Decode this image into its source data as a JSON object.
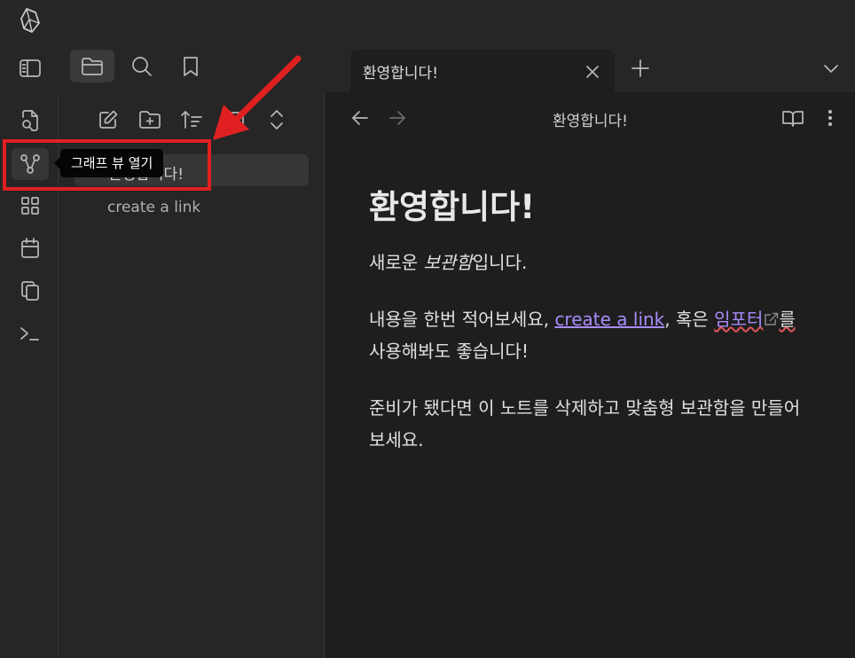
{
  "app": {
    "logo_icon": "obsidian-logo-icon"
  },
  "tabs": [
    {
      "title": "환영합니다!",
      "active": true
    }
  ],
  "tooltip": {
    "text": "그래프 뷰 열기"
  },
  "file_explorer": {
    "items": [
      {
        "label": "환영합니다!",
        "selected": true
      },
      {
        "label": "create a link",
        "selected": false
      }
    ]
  },
  "editor": {
    "view_title": "환영합니다!",
    "heading": "환영합니다!",
    "p1": {
      "pre": "새로운 ",
      "em": "보관함",
      "post": "입니다."
    },
    "p2": {
      "pre": "내용을 한번 적어보세요, ",
      "link": "create a link",
      "mid": ", 혹은 ",
      "ext_link": "임포터",
      "post_wavy": "를",
      "post": " 사용해봐도 좋습니다!"
    },
    "p3": "준비가 됐다면 이 노트를 삭제하고 맞춤형 보관함을 만들어보세요."
  },
  "colors": {
    "accent": "#a88bfa",
    "annotation": "#e02020",
    "background": "#1e1e1e",
    "chrome": "#262626"
  }
}
